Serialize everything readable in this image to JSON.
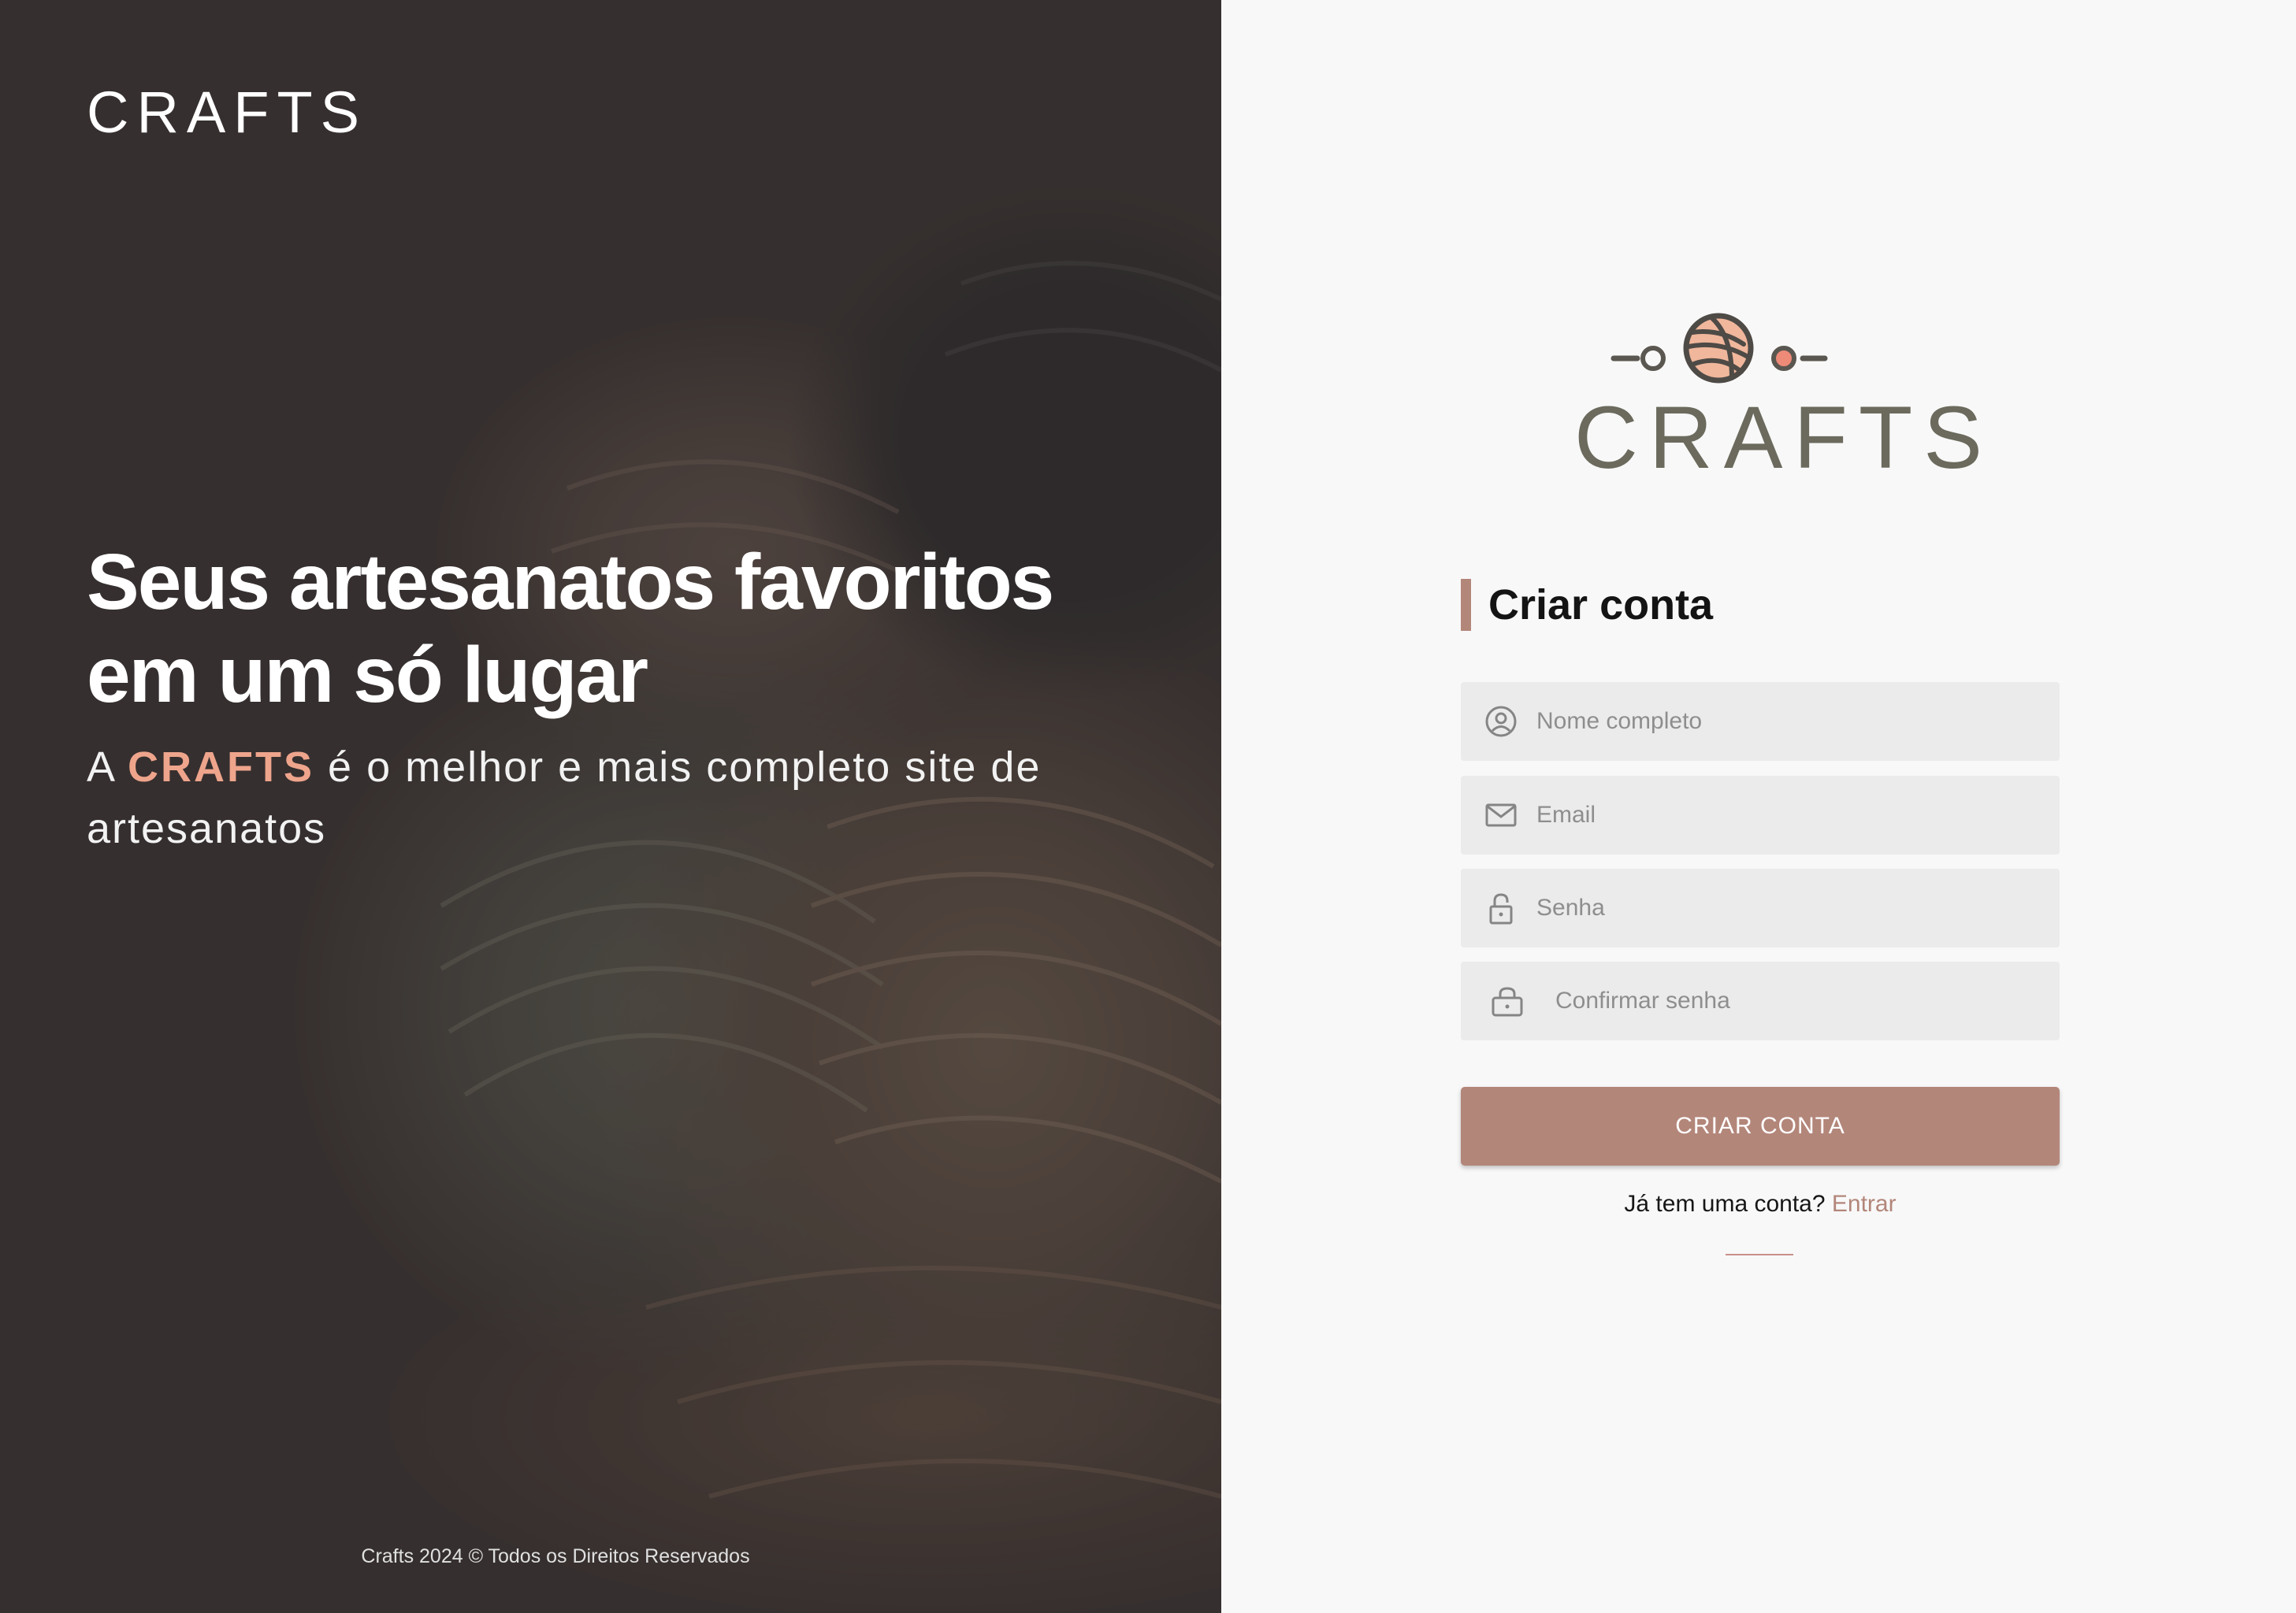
{
  "hero": {
    "logo": "CRAFTS",
    "title": "Seus artesanatos favoritos em um só lugar",
    "subtitle_before": "A ",
    "subtitle_brand": "CRAFTS",
    "subtitle_after": " é o melhor e mais completo site de artesanatos",
    "footer": "Crafts 2024 © Todos os Direitos Reservados"
  },
  "panel": {
    "logo_text": "CRAFTS",
    "form_title": "Criar conta",
    "fields": {
      "name_placeholder": "Nome completo",
      "email_placeholder": "Email",
      "password_placeholder": "Senha",
      "confirm_placeholder": "Confirmar senha"
    },
    "submit_label": "CRIAR CONTA",
    "signin_prompt": "Já tem uma conta? ",
    "signin_link": "Entrar"
  },
  "colors": {
    "accent": "#b3867a",
    "brand_highlight": "#eea58c",
    "logo_gray": "#6b6a5d",
    "field_bg": "#ebebeb"
  },
  "icons": [
    "user-circle-icon",
    "mail-icon",
    "lock-icon",
    "lock-alt-icon",
    "yarn-ball-icon"
  ]
}
